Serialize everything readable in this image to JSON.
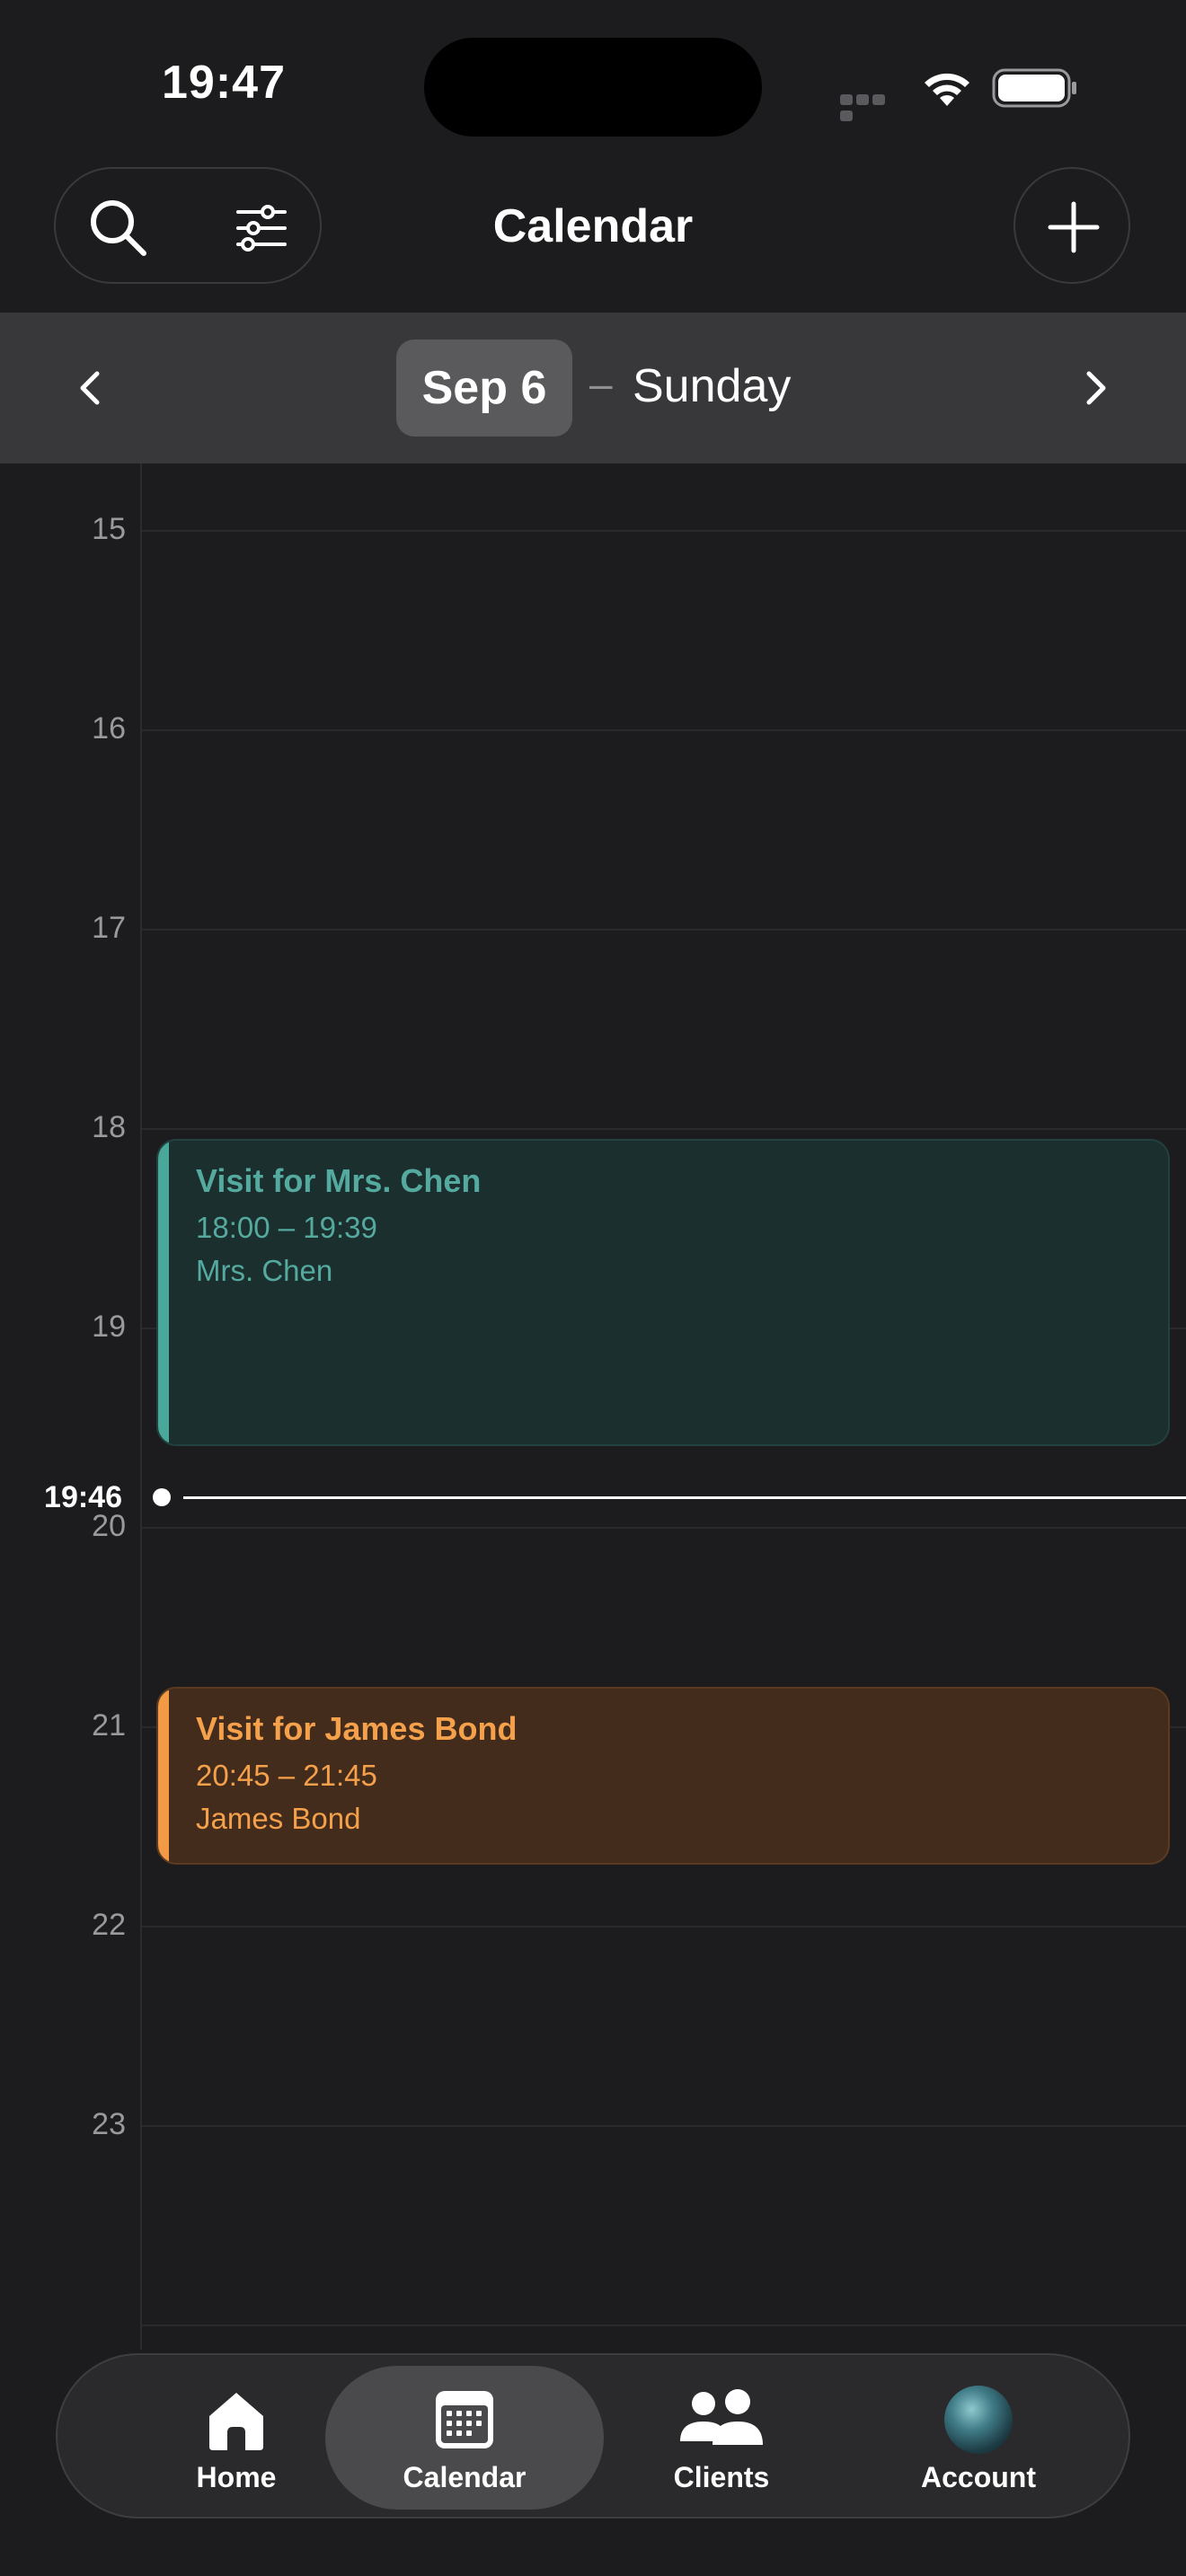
{
  "status_bar": {
    "time": "19:47"
  },
  "header": {
    "title": "Calendar"
  },
  "date_nav": {
    "date": "Sep 6",
    "separator": "–",
    "weekday": "Sunday"
  },
  "timeline": {
    "hours": [
      "15",
      "16",
      "17",
      "18",
      "19",
      "20",
      "21",
      "22",
      "23"
    ],
    "now_label": "19:46",
    "events": [
      {
        "title": "Visit for Mrs. Chen",
        "time": "18:00 – 19:39",
        "client": "Mrs. Chen",
        "color": "#4aa89a"
      },
      {
        "title": "Visit for James Bond",
        "time": "20:45 – 21:45",
        "client": "James Bond",
        "color": "#f29a45"
      }
    ]
  },
  "tab_bar": {
    "items": [
      {
        "label": "Home",
        "icon": "home-icon"
      },
      {
        "label": "Calendar",
        "icon": "calendar-icon",
        "active": true
      },
      {
        "label": "Clients",
        "icon": "clients-icon"
      },
      {
        "label": "Account",
        "icon": "avatar"
      }
    ]
  }
}
